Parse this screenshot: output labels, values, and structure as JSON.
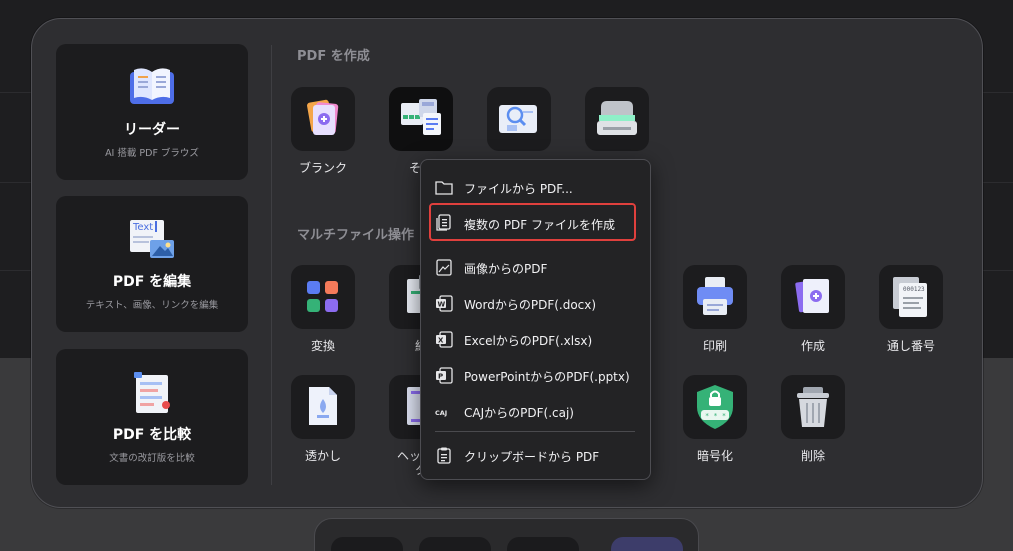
{
  "sidebar": {
    "reader": {
      "title": "リーダー",
      "subtitle": "AI 搭載 PDF ブラウズ"
    },
    "edit": {
      "title": "PDF を編集",
      "subtitle": "テキスト、画像、リンクを編集",
      "art_text": "Text"
    },
    "compare": {
      "title": "PDF を比較",
      "subtitle": "文書の改訂版を比較"
    }
  },
  "create_section": {
    "title": "PDF を作成",
    "tools": [
      {
        "label": "ブランク",
        "icon": "blank-document-icon"
      },
      {
        "label": "その",
        "icon": "other-sources-icon"
      },
      {
        "label": "",
        "icon": "image-to-pdf-icon"
      },
      {
        "label": "",
        "icon": "scanner-icon"
      }
    ]
  },
  "multi_section": {
    "title": "マルチファイル操作",
    "tools": [
      {
        "label": "変換",
        "icon": "convert-icon"
      },
      {
        "label": "結",
        "icon": "merge-icon"
      },
      {
        "label": "印刷",
        "icon": "printer-icon"
      },
      {
        "label": "作成",
        "icon": "create-icon"
      },
      {
        "label": "通し番号",
        "icon": "bates-numbering-icon",
        "art_text": "000123"
      },
      {
        "label": "透かし",
        "icon": "watermark-icon"
      },
      {
        "label": "ヘッダー",
        "label2": "タ",
        "icon": "header-footer-icon"
      },
      {
        "label": "暗号化",
        "icon": "encrypt-shield-icon",
        "art_text": "* * *"
      },
      {
        "label": "削除",
        "icon": "trash-icon"
      }
    ]
  },
  "context_menu": {
    "items": [
      {
        "label": "ファイルから PDF...",
        "icon": "folder-icon"
      },
      {
        "label": "複数の PDF ファイルを作成",
        "icon": "multiple-files-icon",
        "highlighted": true
      },
      {
        "label": "画像からのPDF",
        "icon": "image-file-icon"
      },
      {
        "label": "WordからのPDF(.docx)",
        "icon": "word-icon",
        "badge": "W"
      },
      {
        "label": "ExcelからのPDF(.xlsx)",
        "icon": "excel-icon",
        "badge": "X"
      },
      {
        "label": "PowerPointからのPDF(.pptx)",
        "icon": "powerpoint-icon",
        "badge": "P"
      },
      {
        "label": "CAJからのPDF(.caj)",
        "icon": "caj-icon",
        "badge": "CAJ"
      },
      {
        "label": "クリップボードから PDF",
        "icon": "clipboard-icon"
      }
    ]
  },
  "colors": {
    "highlight_border": "#e0403d",
    "panel_bg": "#2e2e31",
    "tile_bg": "#1c1c1e",
    "accent_blue": "#5b7cf2",
    "accent_purple": "#8c6cf0",
    "accent_green": "#35b277"
  }
}
